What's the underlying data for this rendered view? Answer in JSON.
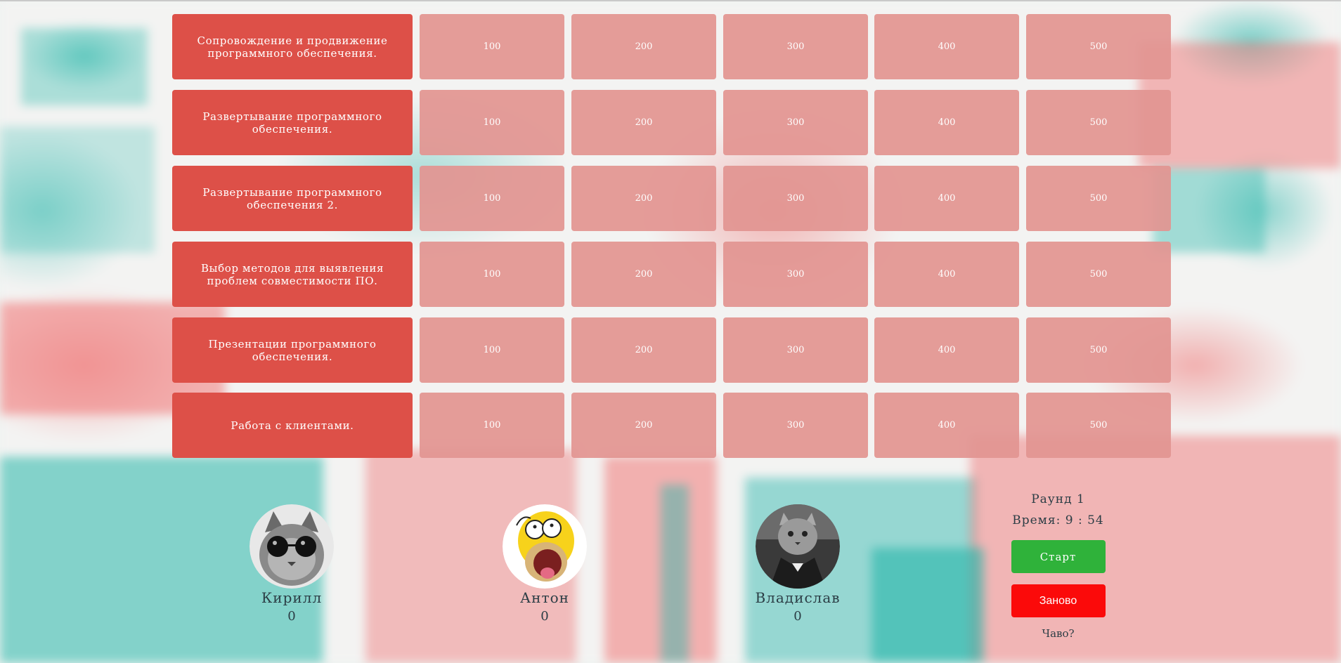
{
  "board": {
    "categories": [
      "Сопровождение и продвижение программного обеспечения.",
      "Развертывание программного обеспечения.",
      "Развертывание программного обеспечения 2.",
      "Выбор методов для выявления проблем совместимости ПО.",
      "Презентации программного обеспечения.",
      "Работа с клиентами."
    ],
    "points": [
      "100",
      "200",
      "300",
      "400",
      "500"
    ],
    "category_color": "#dd5048",
    "cell_color": "#e29491"
  },
  "players": [
    {
      "name": "Кирилл",
      "score": "0",
      "avatar": "cat-with-sunglasses"
    },
    {
      "name": "Антон",
      "score": "0",
      "avatar": "homer-simpson"
    },
    {
      "name": "Владислав",
      "score": "0",
      "avatar": "cat-in-suit"
    }
  ],
  "controls": {
    "round": "Раунд 1",
    "time": "Время: 9 : 54",
    "start_label": "Старт",
    "reset_label": "Заново",
    "help_label": "Чаво?",
    "start_color": "#2fb23a",
    "reset_color": "#fb0a0a"
  }
}
